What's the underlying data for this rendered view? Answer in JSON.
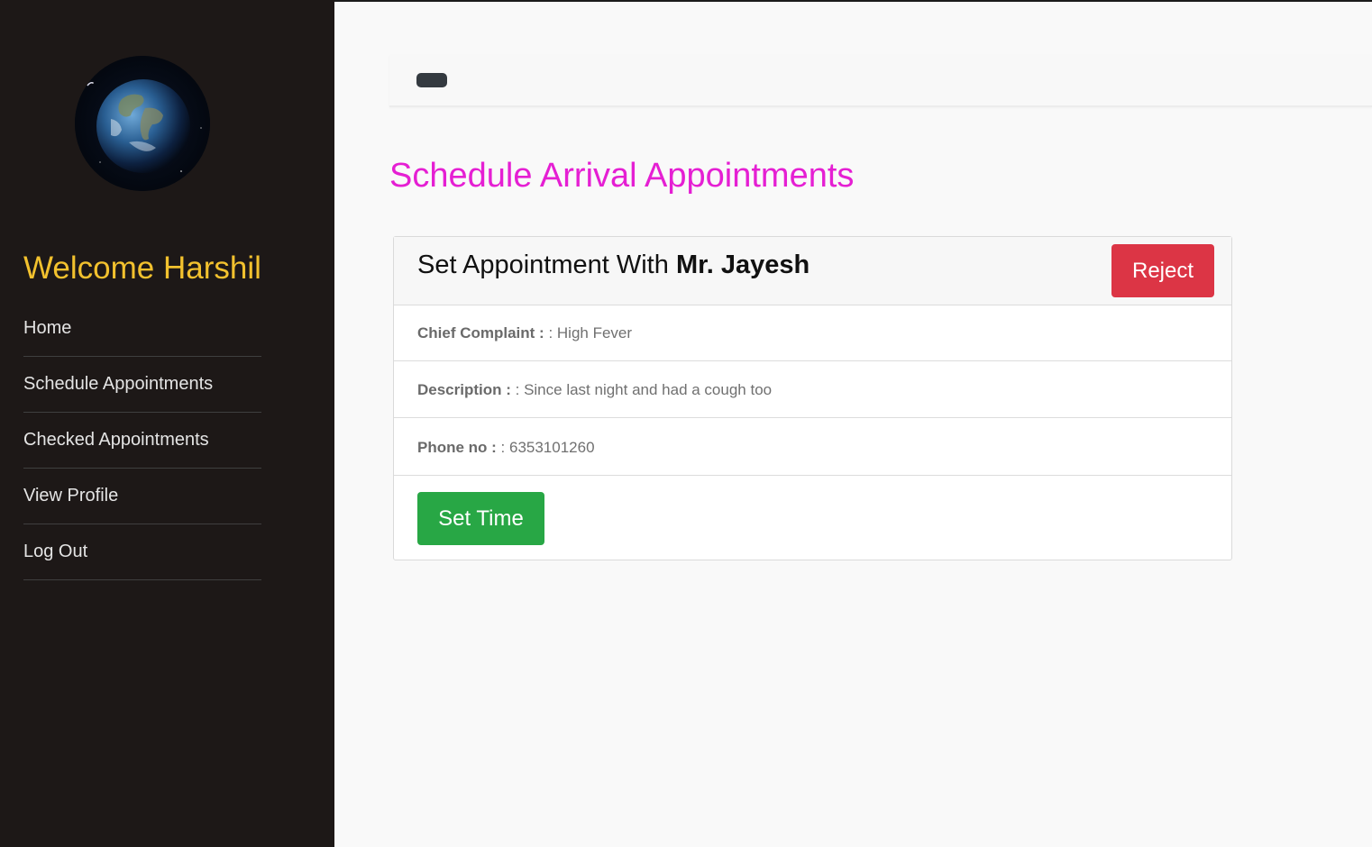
{
  "sidebar": {
    "welcome": "Welcome Harshil",
    "items": [
      {
        "label": "Home"
      },
      {
        "label": "Schedule Appointments"
      },
      {
        "label": "Checked Appointments"
      },
      {
        "label": "View Profile"
      },
      {
        "label": "Log Out"
      }
    ]
  },
  "main": {
    "title": "Schedule Arrival Appointments",
    "card": {
      "header_prefix": "Set Appointment With ",
      "header_name": "Mr. Jayesh",
      "reject_label": "Reject",
      "fields": [
        {
          "label": "Chief Complaint : ",
          "value": ": High Fever"
        },
        {
          "label": "Description : ",
          "value": ": Since last night and had a cough too"
        },
        {
          "label": "Phone no : ",
          "value": ": 6353101260"
        }
      ],
      "set_time_label": "Set Time"
    }
  },
  "colors": {
    "sidebar_bg": "#1d1817",
    "welcome": "#f2c12e",
    "title": "#e51fd3",
    "reject": "#dc3545",
    "set_time": "#28a745"
  }
}
